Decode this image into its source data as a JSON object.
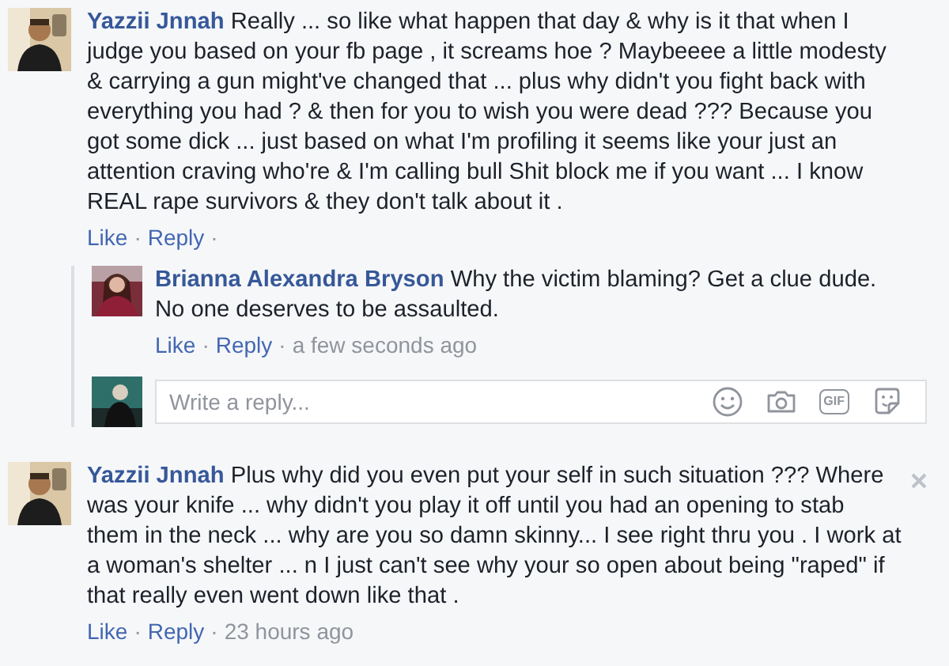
{
  "comments": [
    {
      "author": "Yazzii Jnnah",
      "text": "Really ... so like what happen that day & why is it that when I judge you based on your fb page , it screams hoe ? Maybeeee a little modesty & carrying a gun might've changed that ... plus why didn't you fight back with everything you had ? & then for you to wish you were dead ??? Because you got some dick ... just based on what I'm profiling it seems like your just an attention craving who're & I'm calling bull Shit block me if you want ... I know REAL rape survivors & they don't talk about it .",
      "close_button": false,
      "meta": [
        {
          "kind": "link",
          "text": "Like"
        },
        {
          "kind": "sep",
          "text": "·"
        },
        {
          "kind": "link",
          "text": "Reply"
        },
        {
          "kind": "sep",
          "text": "·"
        }
      ],
      "replies": [
        {
          "author": "Brianna Alexandra Bryson",
          "text": "Why the victim blaming? Get a clue dude. No one deserves to be assaulted.",
          "meta": [
            {
              "kind": "link",
              "text": "Like"
            },
            {
              "kind": "sep",
              "text": "·"
            },
            {
              "kind": "link",
              "text": "Reply"
            },
            {
              "kind": "sep",
              "text": "·"
            },
            {
              "kind": "time",
              "text": "a few seconds ago"
            }
          ]
        }
      ],
      "reply_box": {
        "placeholder": "Write a reply...",
        "gif_label": "GIF"
      }
    },
    {
      "author": "Yazzii Jnnah",
      "text": "Plus why did you even put your self in such situation ??? Where was your knife ... why didn't you play it off until you had an opening to stab them in the neck ... why are you so damn skinny... I see right thru you . I work at a woman's shelter ... n I just can't see why your so open about being \"raped\" if that really even went down like that .",
      "close_button": true,
      "meta": [
        {
          "kind": "link",
          "text": "Like"
        },
        {
          "kind": "sep",
          "text": "·"
        },
        {
          "kind": "link",
          "text": "Reply"
        },
        {
          "kind": "sep",
          "text": "·"
        },
        {
          "kind": "time",
          "text": "23 hours ago"
        }
      ]
    }
  ]
}
